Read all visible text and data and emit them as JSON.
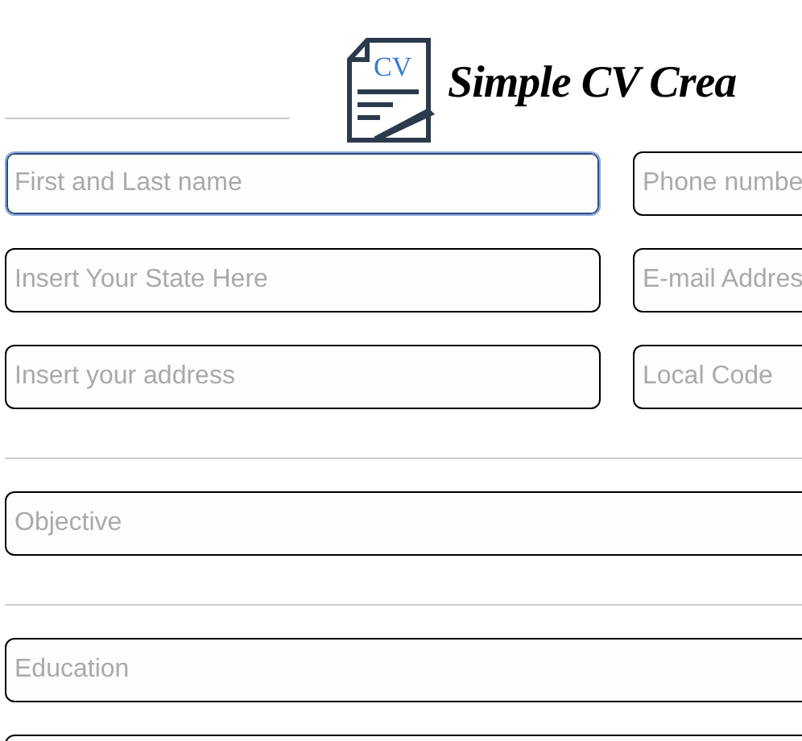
{
  "header": {
    "logo_text": "CV",
    "title": "Simple CV Crea"
  },
  "contact_rows": [
    {
      "left": {
        "placeholder": "First and Last name",
        "focused": true
      },
      "right": {
        "placeholder": "Phone numbe",
        "focused": false
      }
    },
    {
      "left": {
        "placeholder": "Insert Your State Here",
        "focused": false
      },
      "right": {
        "placeholder": "E-mail Addres",
        "focused": false
      }
    },
    {
      "left": {
        "placeholder": "Insert your address",
        "focused": false
      },
      "right": {
        "placeholder": "Local Code",
        "focused": false
      }
    }
  ],
  "sections": [
    {
      "kind": "divider"
    },
    {
      "kind": "field",
      "placeholder": "Objective"
    },
    {
      "kind": "divider"
    },
    {
      "kind": "field",
      "placeholder": "Education"
    },
    {
      "kind": "field"
    }
  ]
}
